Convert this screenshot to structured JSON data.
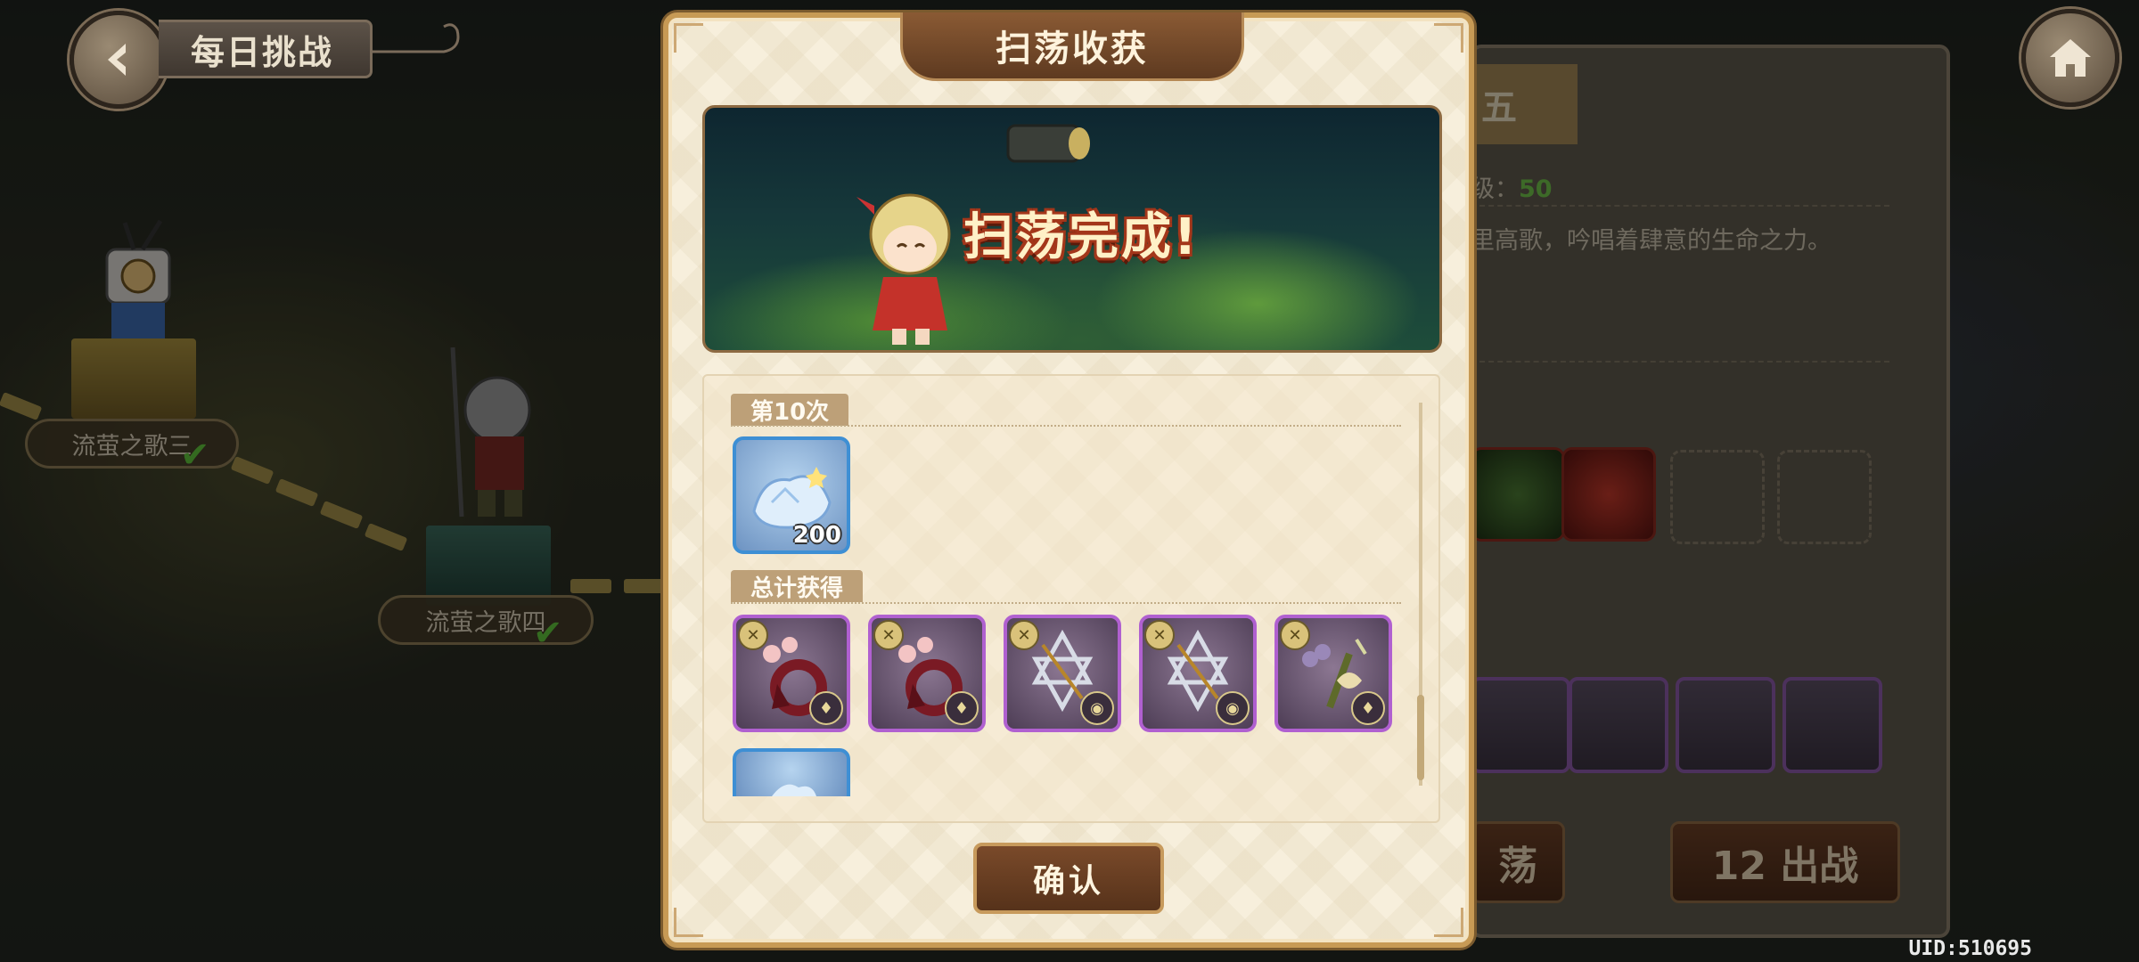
{
  "header": {
    "title": "每日挑战"
  },
  "map": {
    "stages": [
      {
        "label": "流萤之歌三",
        "cleared": true
      },
      {
        "label": "流萤之歌四",
        "cleared": true
      }
    ]
  },
  "right_panel": {
    "tab_fragment": "五",
    "level_fragment": "级：",
    "level_value": "50",
    "desc_fragment": "里高歌，吟唱着肆意的生命之力。",
    "sweep_fragment": "荡",
    "battle_button": "12 出战"
  },
  "modal": {
    "title": "扫荡收获",
    "banner_text": "扫荡完成!",
    "round_tag": "第10次",
    "round_items": [
      {
        "icon": "blue-crystal-shard-icon",
        "quantity": "200"
      }
    ],
    "total_tag": "总计获得",
    "total_items": [
      {
        "icon": "floral-red-charm-icon"
      },
      {
        "icon": "floral-red-charm-icon"
      },
      {
        "icon": "silver-star-bow-icon"
      },
      {
        "icon": "silver-star-bow-icon"
      },
      {
        "icon": "golden-flower-wand-icon"
      }
    ],
    "confirm_label": "确认"
  },
  "uid": "UID:510695",
  "colors": {
    "accent": "#c79a55",
    "rare_purple": "#b060d0",
    "common_blue": "#3e8fd4",
    "level_green": "#6fc24a"
  }
}
